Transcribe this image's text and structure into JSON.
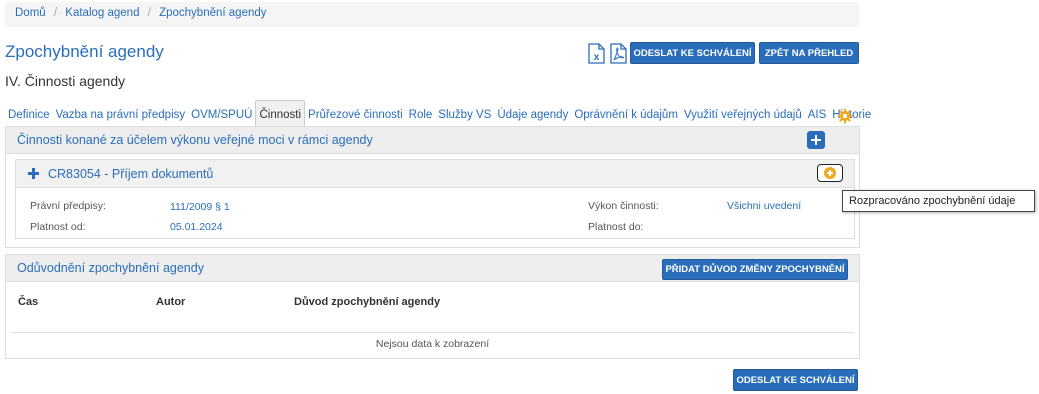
{
  "breadcrumb": {
    "items": [
      "Domů",
      "Katalog agend",
      "Zpochybnění agendy"
    ],
    "separator": "/"
  },
  "page": {
    "title": "Zpochybnění agendy",
    "section": "IV. Činnosti agendy"
  },
  "toolbar": {
    "export_excel_icon": "excel-file-icon",
    "export_pdf_icon": "pdf-file-icon",
    "submit_label": "ODESLAT KE SCHVÁLENÍ",
    "back_label": "ZPĚT NA PŘEHLED"
  },
  "tabs": [
    {
      "label": "Definice"
    },
    {
      "label": "Vazba na právní předpisy"
    },
    {
      "label": "OVM/SPUÚ"
    },
    {
      "label": "Činnosti"
    },
    {
      "label": "Průřezové činnosti"
    },
    {
      "label": "Role"
    },
    {
      "label": "Služby VS"
    },
    {
      "label": "Údaje agendy"
    },
    {
      "label": "Oprávnění k údajům"
    },
    {
      "label": "Využití veřejných údajů"
    },
    {
      "label": "AIS"
    },
    {
      "label": "Historie"
    }
  ],
  "activities_panel": {
    "title": "Činnosti konané za účelem výkonu veřejné moci v rámci agendy",
    "activity": {
      "title": "CR83054 - Příjem dokumentů",
      "legal_label": "Právní předpisy:",
      "legal_value": "111/2009 § 1",
      "valid_from_label": "Platnost od:",
      "valid_from_value": "05.01.2024",
      "execution_label": "Výkon činnosti:",
      "execution_value": "Všichni uvedení",
      "valid_to_label": "Platnost do:",
      "valid_to_value": ""
    },
    "tooltip": "Rozpracováno zpochybnění údaje"
  },
  "reasons_panel": {
    "title": "Odůvodnění zpochybnění agendy",
    "add_button": "PŘIDAT DŮVOD ZMĚNY ZPOCHYBNĚNÍ",
    "columns": [
      "Čas",
      "Autor",
      "Důvod zpochybnění agendy"
    ],
    "empty_text": "Nejsou data k zobrazení"
  },
  "footer": {
    "submit_label": "ODESLAT KE SCHVÁLENÍ"
  },
  "colors": {
    "accent": "#2a6ebb",
    "warning": "#f0a81e"
  }
}
